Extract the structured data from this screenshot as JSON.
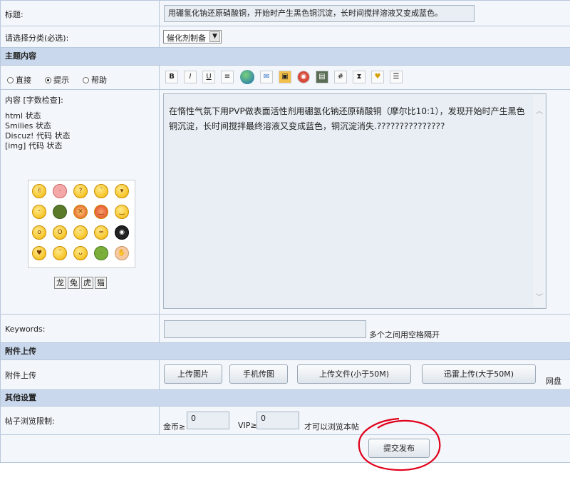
{
  "form": {
    "title_label": "标题:",
    "title_value": "用硼氢化钠还原硝酸铜，开始时产生黑色铜沉淀，长时间搅拌溶液又变成蓝色。",
    "category_label": "请选择分类(必选):",
    "category_value": "催化剂制备",
    "section_content": "主题内容",
    "mode_direct": "直接",
    "mode_hint": "提示",
    "mode_help": "帮助",
    "content_label": "内容 [字数检查]:",
    "status_html": "html 状态",
    "status_smilies": "Smilies 状态",
    "status_discuz": "Discuz! 代码 状态",
    "status_img": "[img] 代码 状态",
    "content_value": "在惰性气氛下用PVP做表面活性剂用硼氢化钠还原硝酸铜（摩尔比10:1），发现开始时产生黑色铜沉淀，长时间搅拌最终溶液又变成蓝色，铜沉淀消失.???????????????",
    "emoticon_tabs": [
      "龙",
      "兔",
      "虎",
      "猫"
    ],
    "keywords_label": "Keywords:",
    "keywords_value": "",
    "keywords_hint": "多个之间用空格隔开",
    "section_attach": "附件上传",
    "attach_label": "附件上传",
    "upload_image": "上传图片",
    "upload_phone": "手机传图",
    "upload_file": "上传文件(小于50M)",
    "upload_xunlei": "迅雷上传(大于50M)",
    "netdisk": "网盘",
    "section_other": "其他设置",
    "view_limit_label": "帖子浏览限制:",
    "gold_label": "金币≥",
    "gold_value": "0",
    "vip_label": "VIP≥",
    "vip_value": "0",
    "view_suffix": "才可以浏览本帖",
    "submit": "提交发布"
  },
  "toolbar_icons": [
    "bold-icon",
    "italic-icon",
    "underline-icon",
    "align-icon",
    "globe-link-icon",
    "email-icon",
    "image-icon",
    "media-icon",
    "film-icon",
    "code-icon",
    "hide-icon",
    "award-icon",
    "list-icon"
  ],
  "colors": {
    "header_bg": "#c9d8ec",
    "border": "#b8c8dc",
    "annotation": "#e0001b"
  }
}
